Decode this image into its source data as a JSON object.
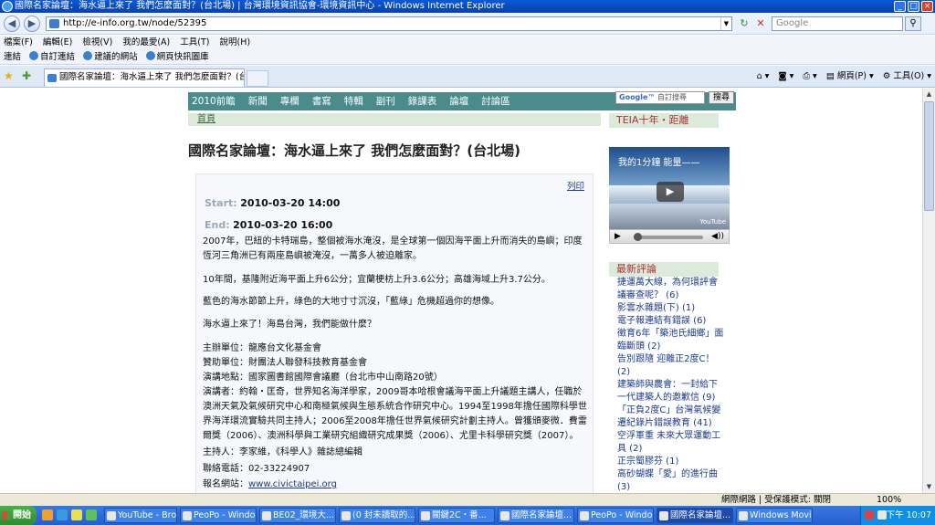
{
  "window": {
    "title": "國際名家論壇：海水逼上來了 我們怎麼面對？(台北場) | 台灣環境資訊協會-環境資訊中心 - Windows Internet Explorer"
  },
  "address": {
    "url": "http://e-info.org.tw/node/52395",
    "search_placeholder": "Google"
  },
  "menu": [
    "檔案(F)",
    "編輯(E)",
    "檢視(V)",
    "我的最愛(A)",
    "工具(T)",
    "說明(H)"
  ],
  "links_bar": {
    "label": "連結",
    "items": [
      "自訂連結",
      "建議的網站",
      "網頁快訊圖庫"
    ]
  },
  "tab": {
    "title": "國際名家論壇：海水逼上來了 我們怎麼面對？(台..."
  },
  "command_bar": [
    "網頁(P)",
    "工具(O)"
  ],
  "site_nav": {
    "items": [
      "2010前瞻",
      "新聞",
      "專欄",
      "書寫",
      "特輯",
      "副刊",
      "錄課表",
      "論壇",
      "討論區"
    ],
    "search_placeholder": "自訂搜尋",
    "search_button": "搜尋",
    "google_logo": "Google™"
  },
  "breadcrumb": "首頁",
  "article": {
    "title": "國際名家論壇：海水逼上來了 我們怎麼面對？(台北場)",
    "print_label": "列印",
    "start_label": "Start:",
    "start_value": "2010-03-20 14:00",
    "end_label": "End:",
    "end_value": "2010-03-20 16:00",
    "paragraphs": [
      "2007年，巴紐的卡特瑞島，整個被海水淹沒，是全球第一個因海平面上升而消失的島嶼；印度恆河三角洲已有兩座島嶼被淹沒，一萬多人被迫離家。",
      "10年間，基隆附近海平面上升6公分；宜蘭梗枋上升3.6公分；高雄海域上升3.7公分。",
      "藍色的海水節節上升，綠色的大地寸寸沉沒，「藍綠」危機超過你的想像。",
      "海水逼上來了！海島台灣，我們能做什麼？"
    ],
    "organizer": "主辦單位：龍應台文化基金會",
    "sponsor": "贊助單位：財團法人聯發科技教育基金會",
    "venue": "演講地點：國家圖書館國際會議廳（台北市中山南路20號）",
    "speaker": "演講者：約翰・匡奇，世界知名海洋學家，2009哥本哈根會議海平面上升議題主講人，任職於澳洲天氣及氣候研究中心和南極氣候與生態系統合作研究中心。1994至1998年擔任國際科學世界海洋環流實驗共同主持人；2006至2008年擔任世界氣候研究計劃主持人。曾獲頒麥微．費雷爾獎（2006）、澳洲科學與工業研究組織研究成果獎（2006）、尤里卡科學研究獎（2007）。",
    "host": "主持人：李家維，《科學人》雜誌總編輯",
    "phone": "聯絡電話：02-33224907",
    "signup_label": "報名網站：",
    "signup_link": "www.civictaipei.org"
  },
  "sidebar": {
    "section1_title": "TEIA十年・距離",
    "video_title": "我的1分鐘 能量——",
    "video_brand": "YouTube",
    "section2_title": "最新評論",
    "comments": [
      "捷運萬大線，為何環評會議審查呢？ (6)",
      "影雲水雜題(下) (1)",
      "電子報連結有錯誤 (6)",
      "徵育6年「築池氏細鄉」面臨斷頭 (2)",
      "告別跟隨 迎離正2度C！ (2)",
      "建築師與農會：一封給下一代建築人的邀歉信 (9)",
      "「正負2度C」台灣氣候變遷紀錄片錯誤教育 (41)",
      "空浮軍重 未來大眾運動工具 (2)",
      "正宗蜀膠芬 (1)",
      "高砂蝴蝶「愛」的進行曲 (3)"
    ]
  },
  "status": {
    "zone": "網際網路 | 受保護模式: 關閉",
    "zoom": "100%"
  },
  "taskbar": {
    "start": "開始",
    "buttons": [
      "YouTube - Bro...",
      "PeoPo - Windo...",
      "BE02_環境大...",
      "(0 封未讀取的...",
      "關鍵2C・番...",
      "國際名家論壇...",
      "PeoPo - Windo...",
      "國際名家論壇...",
      "Windows Movi..."
    ],
    "clock": "下午 10:07"
  },
  "colors": {
    "site_nav": "#4a8c8c",
    "sidebar_heading": "#dbeadb",
    "sidebar_heading_text": "#aa3333",
    "link": "#1a3a8a"
  }
}
